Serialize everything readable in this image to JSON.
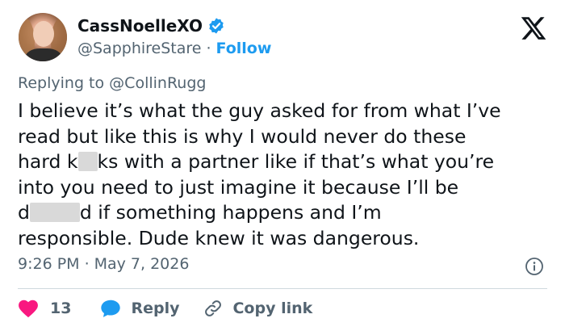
{
  "author": {
    "display_name": "CassNoelleXO",
    "handle": "@SapphireStare",
    "separator": "·",
    "follow_label": "Follow",
    "verified": true
  },
  "reply_context": {
    "prefix": "Replying to",
    "mention": "@CollinRugg"
  },
  "tweet": {
    "lines": [
      [
        "I believe it’s what the guy asked for from what I’ve"
      ],
      [
        "read but like this is why I would never do these"
      ],
      [
        "hard k",
        "ks with a partner like if that’s what you’re"
      ],
      [
        "into you need to just imagine it because I’ll be"
      ],
      [
        "d",
        "d if something happens and I’m"
      ],
      [
        "responsible. Dude knew it was dangerous."
      ]
    ]
  },
  "meta": {
    "time": "9:26 PM",
    "separator": "·",
    "date": "May 7, 2026"
  },
  "actions": {
    "like_count": "13",
    "reply_label": "Reply",
    "copy_link_label": "Copy link"
  },
  "colors": {
    "text": "#0f1419",
    "secondary": "#536471",
    "accent": "#1d9bf0",
    "like": "#f91880",
    "divider": "#cfd9de",
    "redaction": "#d9d9d9"
  },
  "icons": {
    "verified": "verified-badge-icon",
    "logo": "x-logo-icon",
    "info": "info-icon",
    "like": "heart-icon",
    "reply": "speech-bubble-icon",
    "copy": "link-icon"
  }
}
